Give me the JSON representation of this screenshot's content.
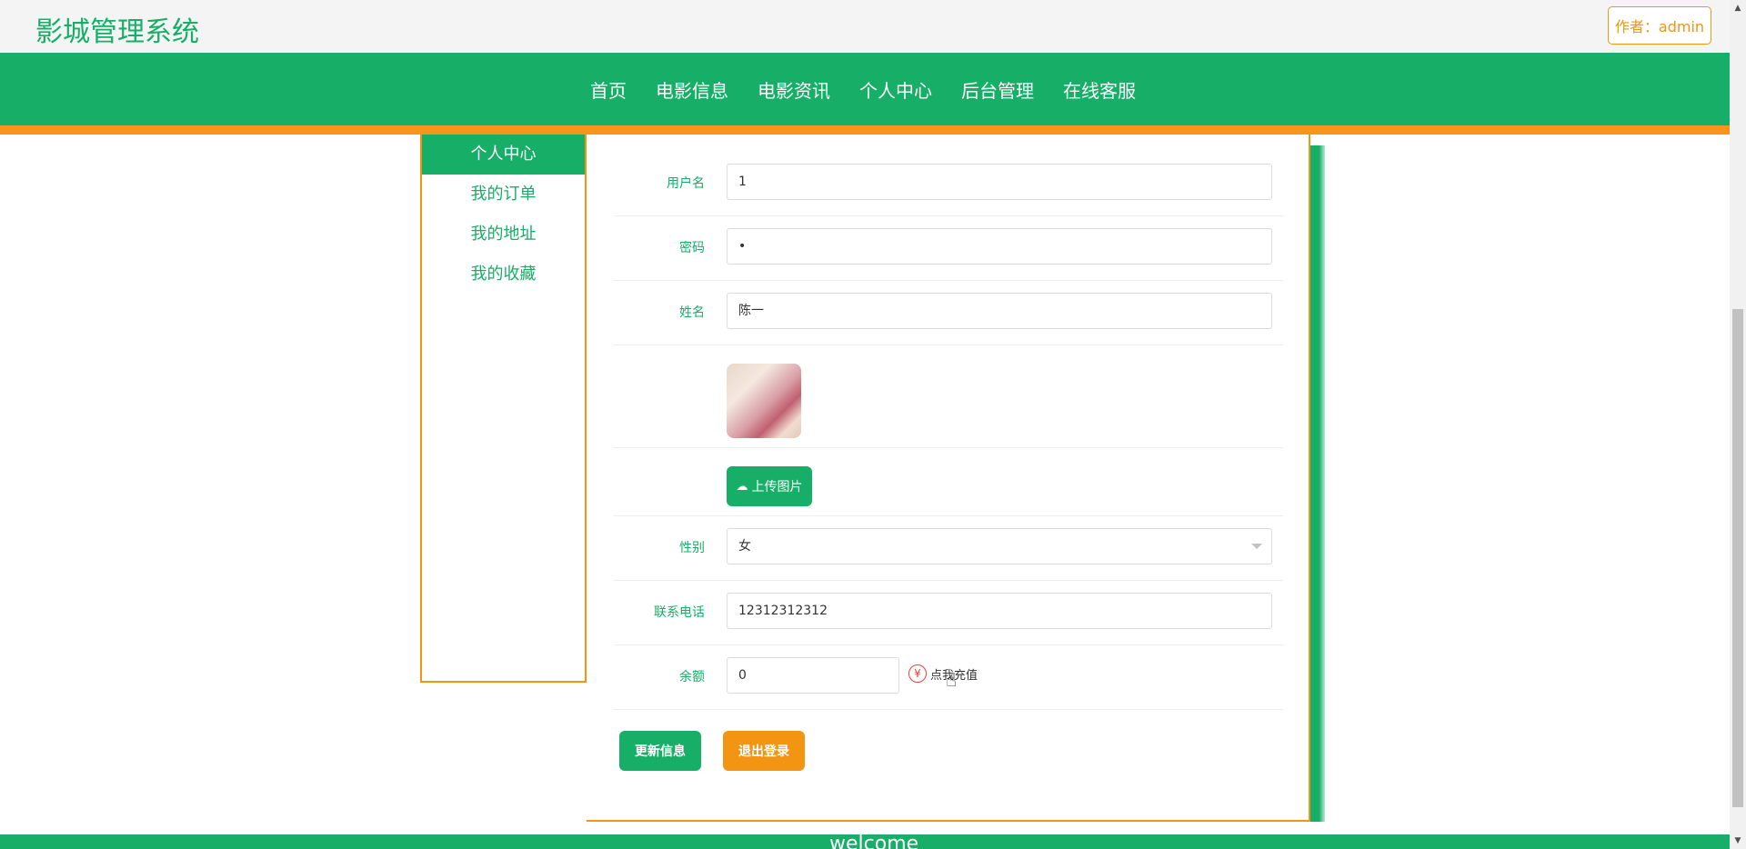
{
  "header": {
    "site_title": "影城管理系统",
    "author_label": "作者：admin"
  },
  "nav": {
    "items": [
      "首页",
      "电影信息",
      "电影资讯",
      "个人中心",
      "后台管理",
      "在线客服"
    ]
  },
  "sidebar": {
    "items": [
      {
        "label": "个人中心",
        "active": true
      },
      {
        "label": "我的订单",
        "active": false
      },
      {
        "label": "我的地址",
        "active": false
      },
      {
        "label": "我的收藏",
        "active": false
      }
    ]
  },
  "form": {
    "username": {
      "label": "用户名",
      "value": "1"
    },
    "password": {
      "label": "密码",
      "value": "•"
    },
    "name": {
      "label": "姓名",
      "value": "陈一"
    },
    "upload_label": "上传图片",
    "gender": {
      "label": "性别",
      "value": "女"
    },
    "phone": {
      "label": "联系电话",
      "value": "12312312312"
    },
    "balance": {
      "label": "余额",
      "value": "0"
    },
    "recharge_label": "点我充值"
  },
  "actions": {
    "update_label": "更新信息",
    "logout_label": "退出登录"
  },
  "footer": {
    "text": "welcome"
  },
  "colors": {
    "primary": "#17ae67",
    "accent": "#f39412"
  }
}
